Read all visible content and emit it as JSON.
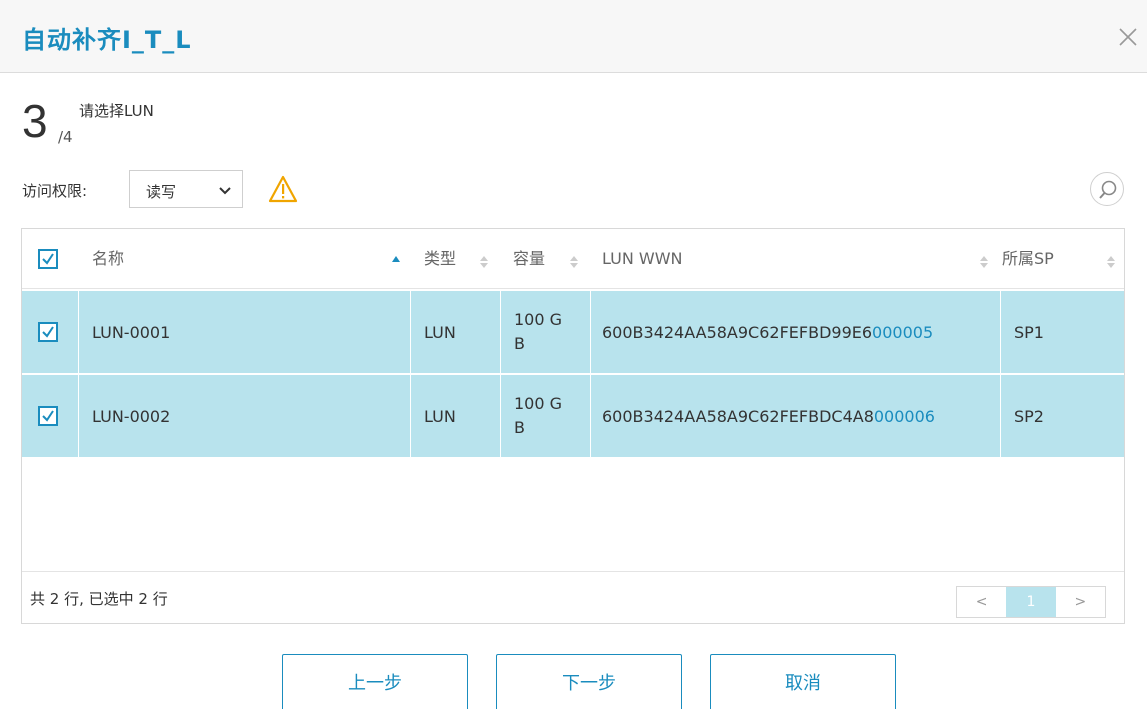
{
  "dialog": {
    "title": "自动补齐I_T_L"
  },
  "step": {
    "current": "3",
    "total": "/4",
    "title": "请选择LUN"
  },
  "access": {
    "label": "访问权限:",
    "selected": "读写"
  },
  "table": {
    "columns": [
      "名称",
      "类型",
      "容量",
      "LUN WWN",
      "所属SP"
    ],
    "rows": [
      {
        "name": "LUN-0001",
        "type": "LUN",
        "capacity_line1": "100 G",
        "capacity_line2": "B",
        "wwn_prefix": "600B3424AA58A9C62FEFBD99E6",
        "wwn_suffix": "000005",
        "sp": "SP1",
        "checked": true
      },
      {
        "name": "LUN-0002",
        "type": "LUN",
        "capacity_line1": "100 G",
        "capacity_line2": "B",
        "wwn_prefix": "600B3424AA58A9C62FEFBDC4A8",
        "wwn_suffix": "000006",
        "sp": "SP2",
        "checked": true
      }
    ],
    "summary": "共 2 行, 已选中 2 行",
    "pager": {
      "prev": "<",
      "page": "1",
      "next": ">"
    }
  },
  "buttons": {
    "prev": "上一步",
    "next": "下一步",
    "cancel": "取消"
  },
  "icons": {
    "close": "close-icon",
    "dropdown": "chevron-down-icon",
    "warning": "warning-icon",
    "search": "search-icon",
    "checkbox": "checkbox-checked-icon",
    "sort_asc": "sort-asc-icon",
    "sort": "sort-icon"
  },
  "colors": {
    "accent": "#1a8cbe",
    "row_selected": "#b8e3ed",
    "warning": "#f0a500",
    "header_bg": "#f7f7f7"
  }
}
